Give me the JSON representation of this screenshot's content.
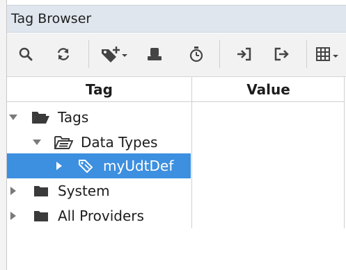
{
  "panel": {
    "title": "Tag Browser"
  },
  "toolbar": {
    "buttons": [
      {
        "name": "search-button",
        "icon": "search-icon"
      },
      {
        "name": "refresh-button",
        "icon": "refresh-icon"
      },
      {
        "name": "add-tag-button",
        "icon": "tag-plus-icon"
      },
      {
        "name": "edit-tag-button",
        "icon": "tag-edit-icon"
      },
      {
        "name": "history-button",
        "icon": "clock-icon"
      },
      {
        "name": "import-button",
        "icon": "import-icon"
      },
      {
        "name": "export-button",
        "icon": "export-icon"
      },
      {
        "name": "columns-button",
        "icon": "table-icon"
      }
    ]
  },
  "grid": {
    "columns": [
      "Tag",
      "Value"
    ],
    "rows": [
      {
        "label": "Tags",
        "icon": "folder-open-icon",
        "expanded": true,
        "level": 0
      },
      {
        "label": "Data Types",
        "icon": "folder-open-outline-icon",
        "expanded": true,
        "level": 1
      },
      {
        "label": "myUdtDef",
        "icon": "udt-tag-icon",
        "expanded": false,
        "level": 2,
        "selected": true
      },
      {
        "label": "System",
        "icon": "folder-icon",
        "expanded": false,
        "level": 0
      },
      {
        "label": "All Providers",
        "icon": "folder-icon",
        "expanded": false,
        "level": 0
      }
    ]
  },
  "colors": {
    "selection": "#3d8fe0",
    "title_bar": "#dfe6ee",
    "icon_dark": "#444444"
  }
}
